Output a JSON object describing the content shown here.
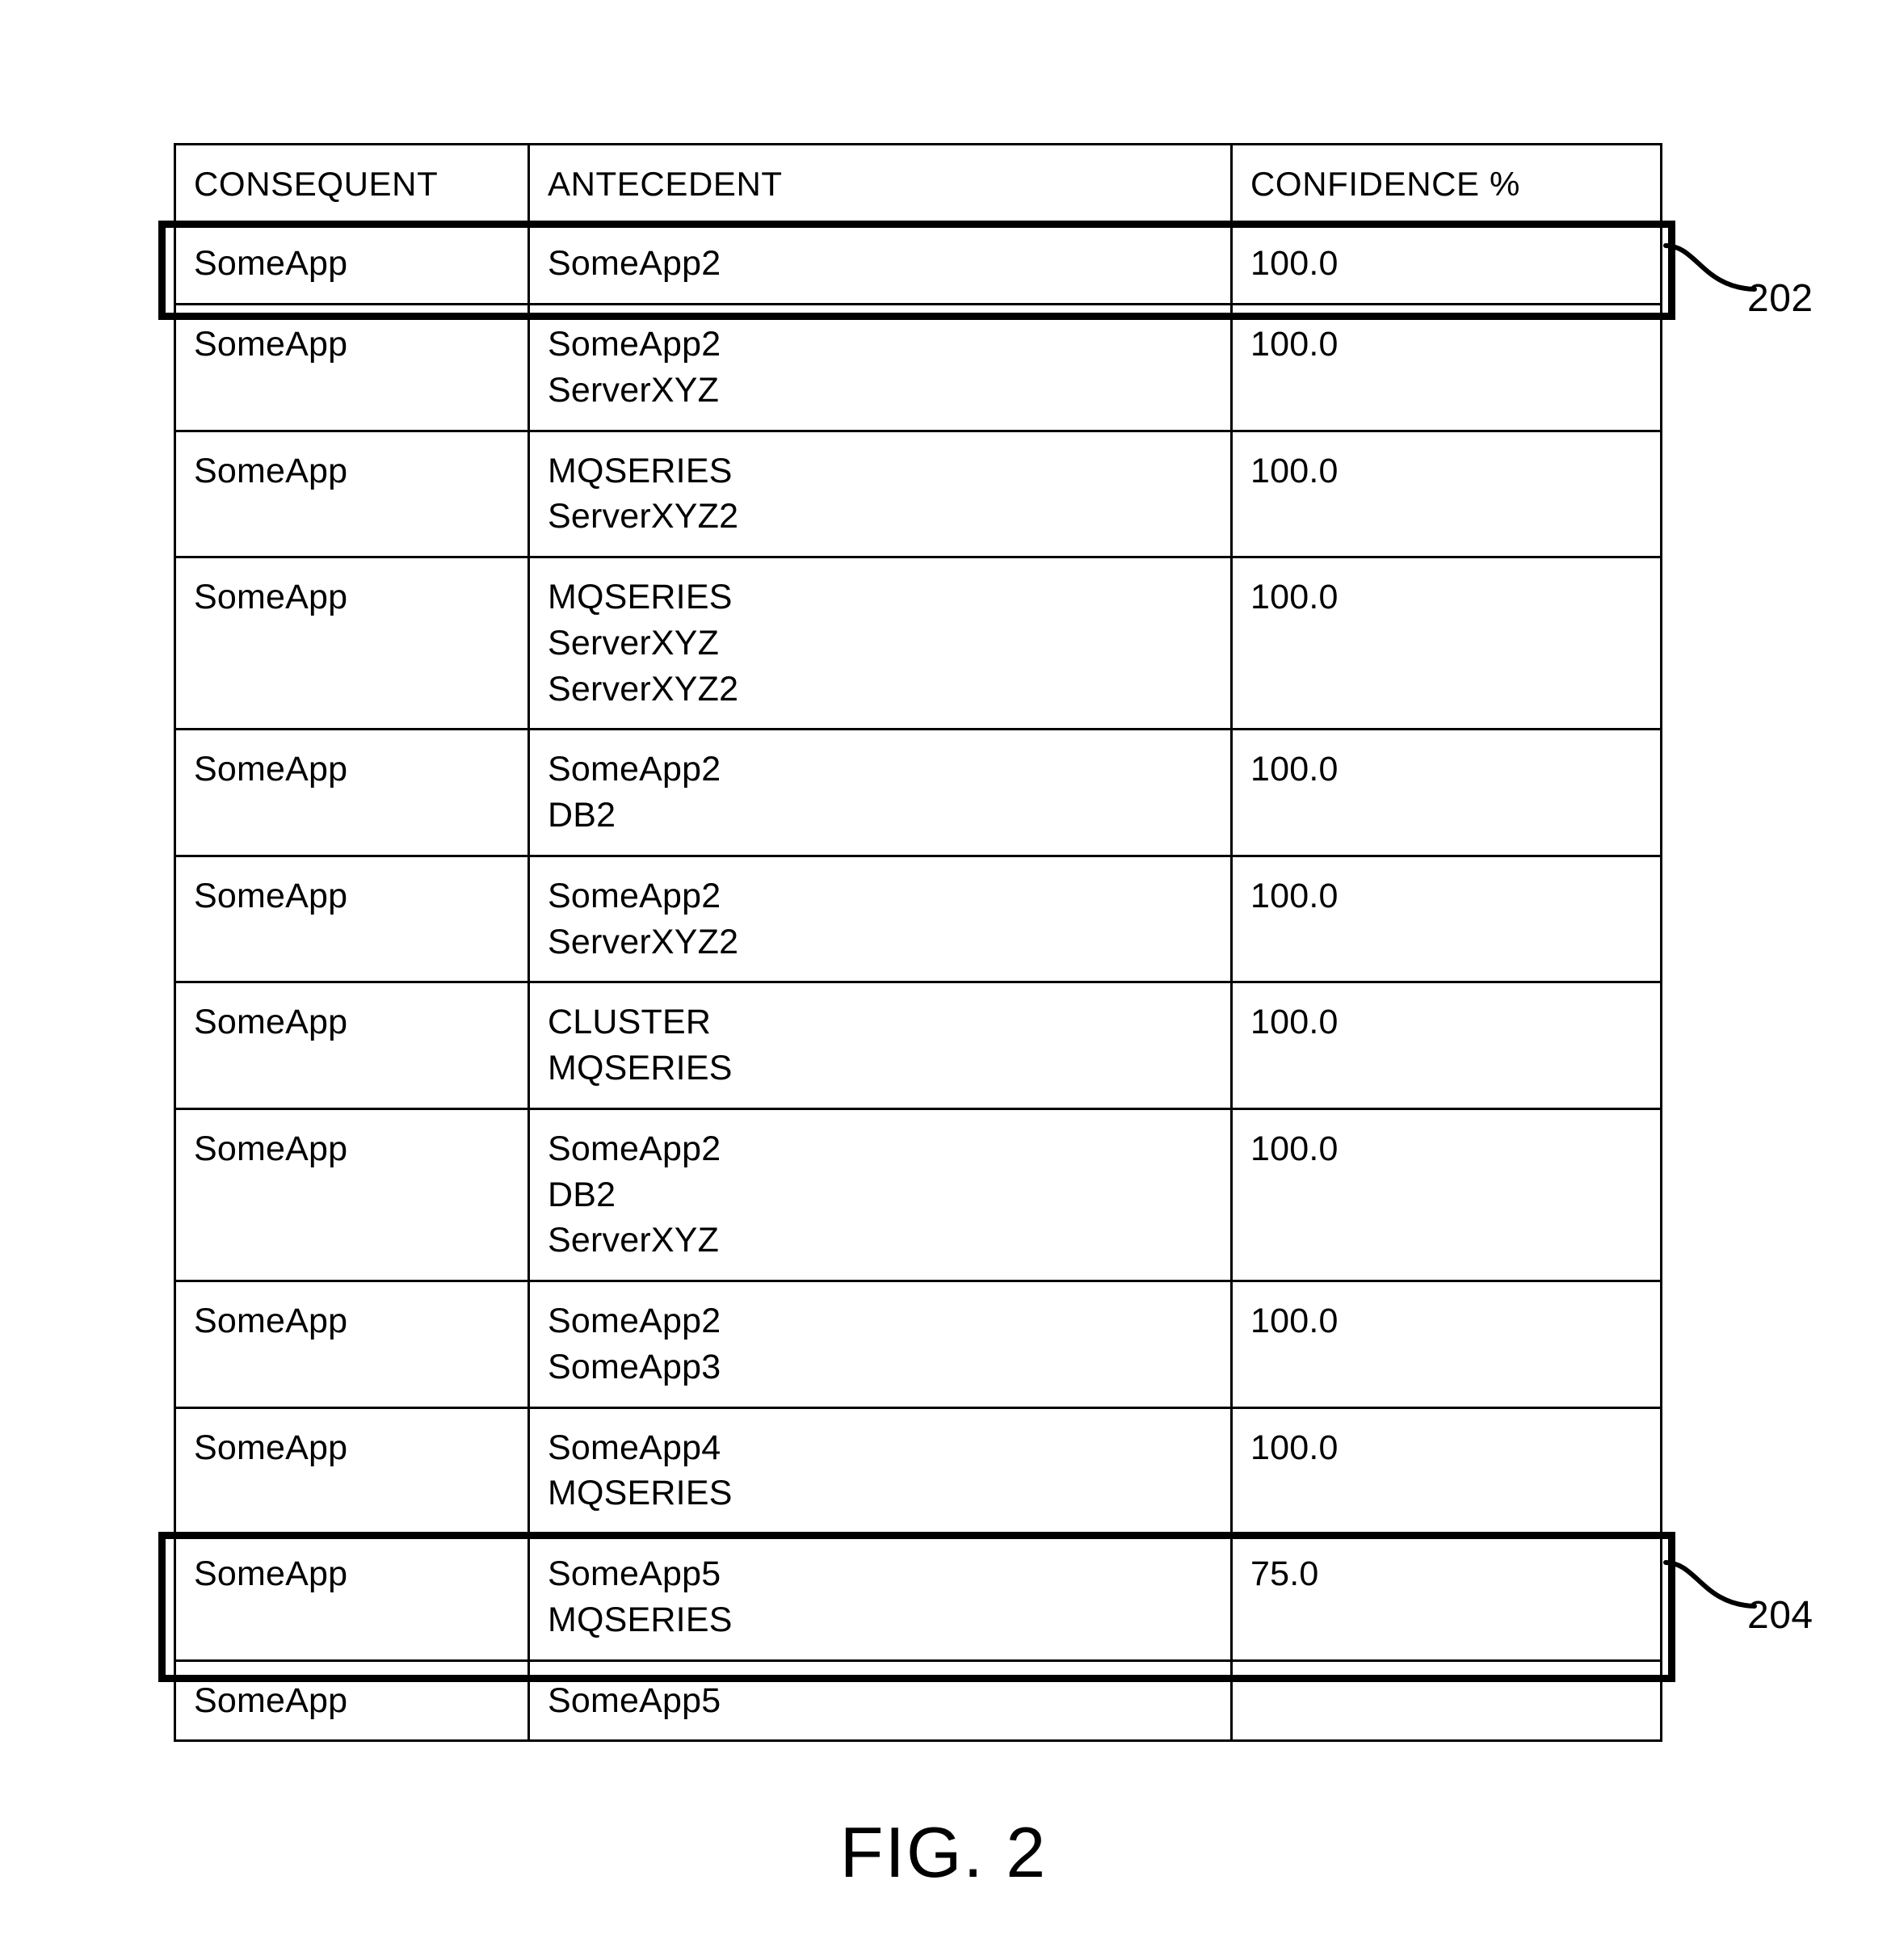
{
  "figure": {
    "caption": "FIG. 2",
    "reference_numerals": [
      {
        "id": "202",
        "label": "202",
        "target": "row-1"
      },
      {
        "id": "204",
        "label": "204",
        "target": "row-11"
      }
    ]
  },
  "table": {
    "columns": [
      {
        "key": "consequent",
        "header": "CONSEQUENT"
      },
      {
        "key": "antecedent",
        "header": "ANTECEDENT"
      },
      {
        "key": "confidence",
        "header": "CONFIDENCE %"
      }
    ],
    "rows": [
      {
        "consequent": "SomeApp",
        "antecedent": "SomeApp2",
        "confidence": "100.0",
        "highlighted": true,
        "callout": "202"
      },
      {
        "consequent": "SomeApp",
        "antecedent": "SomeApp2\nServerXYZ",
        "confidence": "100.0",
        "highlighted": false,
        "callout": ""
      },
      {
        "consequent": "SomeApp",
        "antecedent": "MQSERIES\nServerXYZ2",
        "confidence": "100.0",
        "highlighted": false,
        "callout": ""
      },
      {
        "consequent": "SomeApp",
        "antecedent": "MQSERIES\nServerXYZ\nServerXYZ2",
        "confidence": "100.0",
        "highlighted": false,
        "callout": ""
      },
      {
        "consequent": "SomeApp",
        "antecedent": "SomeApp2\nDB2",
        "confidence": "100.0",
        "highlighted": false,
        "callout": ""
      },
      {
        "consequent": "SomeApp",
        "antecedent": "SomeApp2\nServerXYZ2",
        "confidence": "100.0",
        "highlighted": false,
        "callout": ""
      },
      {
        "consequent": "SomeApp",
        "antecedent": "CLUSTER\nMQSERIES",
        "confidence": "100.0",
        "highlighted": false,
        "callout": ""
      },
      {
        "consequent": "SomeApp",
        "antecedent": "SomeApp2\nDB2\nServerXYZ",
        "confidence": "100.0",
        "highlighted": false,
        "callout": ""
      },
      {
        "consequent": "SomeApp",
        "antecedent": "SomeApp2\nSomeApp3",
        "confidence": "100.0",
        "highlighted": false,
        "callout": ""
      },
      {
        "consequent": "SomeApp",
        "antecedent": "SomeApp4\nMQSERIES",
        "confidence": "100.0",
        "highlighted": false,
        "callout": ""
      },
      {
        "consequent": "SomeApp",
        "antecedent": "SomeApp5\nMQSERIES",
        "confidence": "75.0",
        "highlighted": true,
        "callout": "204"
      },
      {
        "consequent": "SomeApp",
        "antecedent": "SomeApp5",
        "confidence": "",
        "highlighted": false,
        "callout": ""
      }
    ]
  },
  "colors": {
    "line": "#000000",
    "background": "#ffffff",
    "text": "#000000"
  }
}
